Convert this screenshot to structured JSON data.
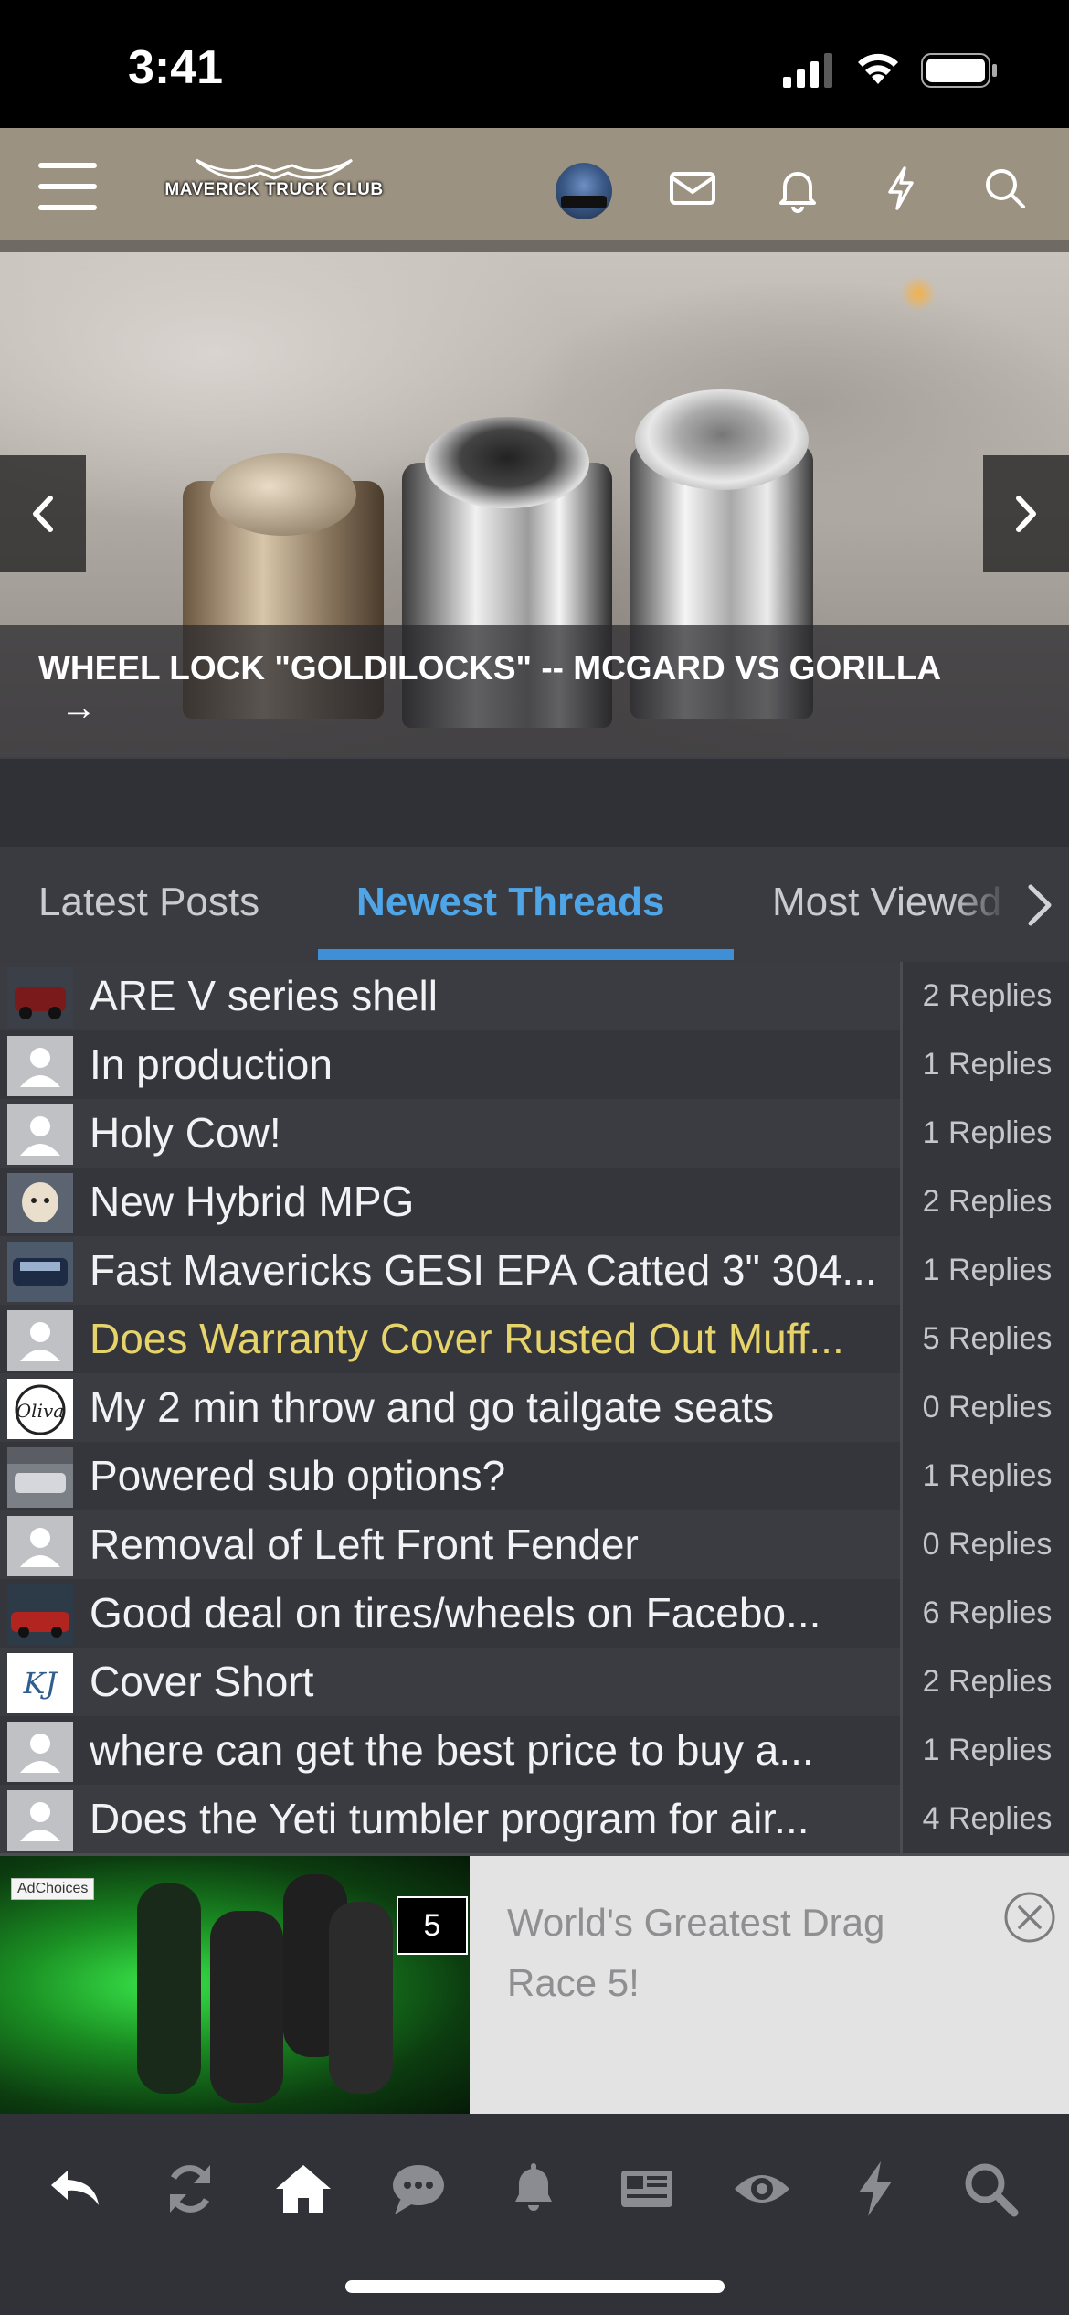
{
  "status_bar": {
    "time": "3:41"
  },
  "header": {
    "logo_text": "MAVERICK TRUCK CLUB",
    "icons": [
      "menu-icon",
      "avatar",
      "mail-icon",
      "bell-icon",
      "lightning-icon",
      "search-icon"
    ]
  },
  "hero": {
    "title": "WHEEL LOCK \"GOLDILOCKS\" -- MCGARD VS GORILLA",
    "arrow": "→"
  },
  "tabs": [
    {
      "label": "Latest Posts",
      "active": false
    },
    {
      "label": "Newest Threads",
      "active": true
    },
    {
      "label": "Most Viewed",
      "active": false
    }
  ],
  "threads": [
    {
      "title": "ARE V series shell",
      "replies": "2 Replies",
      "avatar": "photo-truck-red"
    },
    {
      "title": "In production",
      "replies": "1 Replies",
      "avatar": "default-user"
    },
    {
      "title": "Holy Cow!",
      "replies": "1 Replies",
      "avatar": "default-user"
    },
    {
      "title": "New Hybrid MPG",
      "replies": "2 Replies",
      "avatar": "photo-dog"
    },
    {
      "title": "Fast Mavericks GESI EPA Catted 3\" 304...",
      "replies": "1 Replies",
      "avatar": "photo-truck-blue"
    },
    {
      "title": "Does Warranty Cover Rusted Out Muff...",
      "replies": "5 Replies",
      "avatar": "default-user",
      "highlight": true
    },
    {
      "title": "My 2 min throw and go tailgate seats",
      "replies": "0 Replies",
      "avatar": "logo-olive"
    },
    {
      "title": "Powered sub options?",
      "replies": "1 Replies",
      "avatar": "photo-garage"
    },
    {
      "title": "Removal of Left Front Fender",
      "replies": "0 Replies",
      "avatar": "default-user"
    },
    {
      "title": "Good deal on tires/wheels on Facebo...",
      "replies": "6 Replies",
      "avatar": "photo-car-red"
    },
    {
      "title": "Cover Short",
      "replies": "2 Replies",
      "avatar": "logo-kj"
    },
    {
      "title": "where can get the best price to buy a...",
      "replies": "1 Replies",
      "avatar": "default-user"
    },
    {
      "title": "Does the Yeti tumbler program for air...",
      "replies": "4 Replies",
      "avatar": "default-user"
    }
  ],
  "ad": {
    "adchoices": "AdChoices",
    "timer": "5",
    "text_line1": "World's Greatest Drag",
    "text_line2": "Race 5!"
  },
  "bottom_nav": [
    "back-icon",
    "refresh-icon",
    "home-icon",
    "chat-icon",
    "bell-icon",
    "news-icon",
    "eye-icon",
    "lightning-icon",
    "search-icon"
  ],
  "colors": {
    "header_bg": "#9c9281",
    "accent": "#4ea5e8",
    "highlight_text": "#e6d36a",
    "list_bg": "#3a3c42"
  }
}
